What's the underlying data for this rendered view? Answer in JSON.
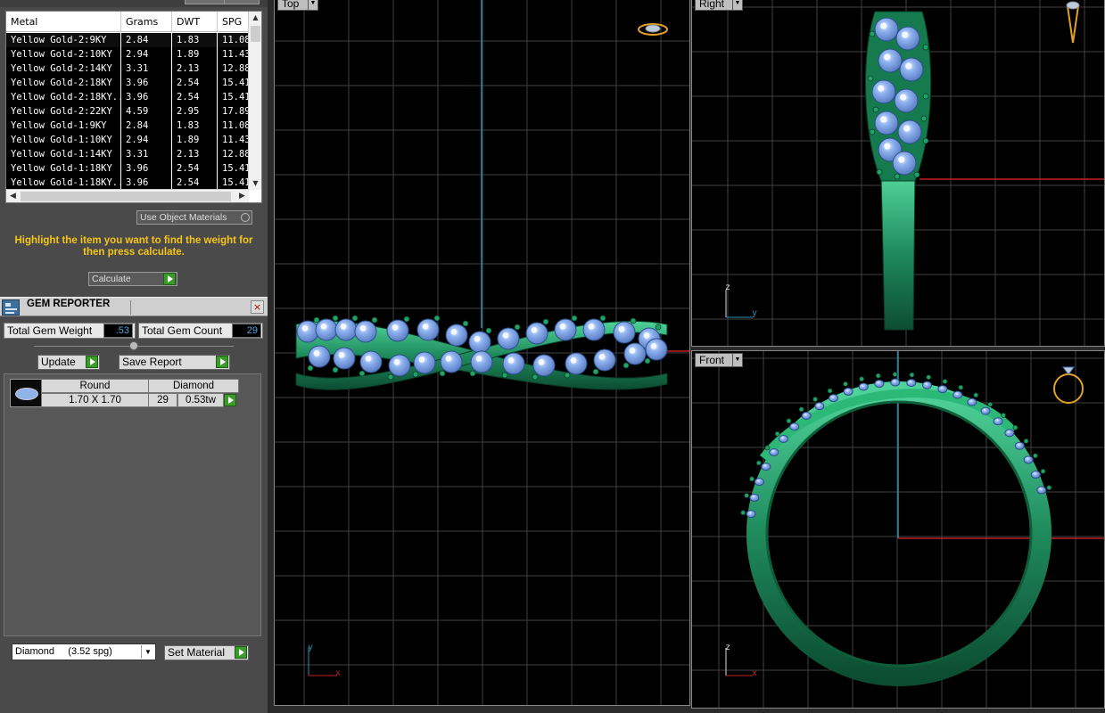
{
  "metal_table": {
    "columns": [
      "Metal",
      "Grams",
      "DWT",
      "SPG"
    ],
    "rows": [
      [
        "Yellow Gold-2:9KY",
        "2.84",
        "1.83",
        "11.08"
      ],
      [
        "Yellow Gold-2:10KY",
        "2.94",
        "1.89",
        "11.43"
      ],
      [
        "Yellow Gold-2:14KY",
        "3.31",
        "2.13",
        "12.88"
      ],
      [
        "Yellow Gold-2:18KY",
        "3.96",
        "2.54",
        "15.41"
      ],
      [
        "Yellow Gold-2:18KY...",
        "3.96",
        "2.54",
        "15.41"
      ],
      [
        "Yellow Gold-2:22KY",
        "4.59",
        "2.95",
        "17.89"
      ],
      [
        "Yellow Gold-1:9KY",
        "2.84",
        "1.83",
        "11.08"
      ],
      [
        "Yellow Gold-1:10KY",
        "2.94",
        "1.89",
        "11.43"
      ],
      [
        "Yellow Gold-1:14KY",
        "3.31",
        "2.13",
        "12.88"
      ],
      [
        "Yellow Gold-1:18KY",
        "3.96",
        "2.54",
        "15.41"
      ],
      [
        "Yellow Gold-1:18KY...",
        "3.96",
        "2.54",
        "15.41"
      ]
    ]
  },
  "use_object_materials": "Use Object Materials",
  "hint": "Highlight the item you want to find the weight for then press calculate.",
  "calculate_label": "Calculate",
  "gem_reporter": {
    "title": "GEM REPORTER",
    "close_glyph": "×",
    "total_weight_label": "Total Gem Weight",
    "total_weight_value": ".53",
    "total_count_label": "Total Gem Count",
    "total_count_value": "29",
    "update_label": "Update",
    "save_report_label": "Save Report",
    "gem_row": {
      "shape": "Round",
      "material": "Diamond",
      "size": "1.70 X 1.70",
      "count": "29",
      "weight": "0.53tw"
    },
    "material_select": "Diamond     (3.52 spg)",
    "set_material_label": "Set Material"
  },
  "viewports": {
    "top": {
      "label": "Top",
      "axis_v": "y",
      "axis_h": "x"
    },
    "right": {
      "label": "Right",
      "axis_v": "z",
      "axis_h": "y"
    },
    "front": {
      "label": "Front",
      "axis_v": "z",
      "axis_h": "x"
    }
  },
  "colors": {
    "ring_green": "#1f8a5c",
    "gem_blue": "#8fb2ef",
    "hint_yellow": "#f5c518",
    "grid": "#3f3f3f",
    "axis_cyan": "#2a8fb0",
    "axis_red": "#c02020"
  },
  "icons": [
    "play-arrow-icon",
    "gem-reporter-icon",
    "close-icon",
    "dropdown-arrow-icon",
    "scroll-arrow-icon",
    "ring-thumbnail-icon"
  ]
}
